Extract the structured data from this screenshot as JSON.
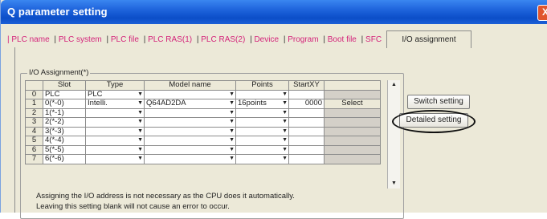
{
  "window": {
    "title": "Q parameter setting",
    "close_glyph": "X"
  },
  "tabs": [
    "PLC name",
    "PLC system",
    "PLC file",
    "PLC RAS(1)",
    "PLC RAS(2)",
    "Device",
    "Program",
    "Boot file",
    "SFC"
  ],
  "active_tab": "I/O assignment",
  "group_label": "I/O Assignment(*)",
  "columns": [
    "Slot",
    "Type",
    "Model name",
    "Points",
    "StartXY"
  ],
  "rows": [
    {
      "no": "0",
      "slot": "PLC",
      "type": "PLC",
      "model": "",
      "points": "",
      "start": "",
      "action": ""
    },
    {
      "no": "1",
      "slot": "0(*-0)",
      "type": "Intelli.",
      "model": "Q64AD2DA",
      "points": "16points",
      "start": "0000",
      "action": "Select"
    },
    {
      "no": "2",
      "slot": "1(*-1)",
      "type": "",
      "model": "",
      "points": "",
      "start": "",
      "action": ""
    },
    {
      "no": "3",
      "slot": "2(*-2)",
      "type": "",
      "model": "",
      "points": "",
      "start": "",
      "action": ""
    },
    {
      "no": "4",
      "slot": "3(*-3)",
      "type": "",
      "model": "",
      "points": "",
      "start": "",
      "action": ""
    },
    {
      "no": "5",
      "slot": "4(*-4)",
      "type": "",
      "model": "",
      "points": "",
      "start": "",
      "action": ""
    },
    {
      "no": "6",
      "slot": "5(*-5)",
      "type": "",
      "model": "",
      "points": "",
      "start": "",
      "action": ""
    },
    {
      "no": "7",
      "slot": "6(*-6)",
      "type": "",
      "model": "",
      "points": "",
      "start": "",
      "action": ""
    }
  ],
  "buttons": {
    "switch": "Switch setting",
    "detailed": "Detailed setting"
  },
  "notes": [
    "Assigning the I/O address is not necessary as the CPU does it automatically.",
    "Leaving this setting blank will not cause an error to occur."
  ],
  "icons": {
    "dropdown": "dropdown-arrow-icon",
    "scroll_up": "scroll-up-icon",
    "scroll_down": "scroll-down-icon"
  },
  "colors": {
    "title_bar": "#0b4ec8",
    "tab_text": "#d4237a",
    "window_bg": "#ece9d8"
  }
}
